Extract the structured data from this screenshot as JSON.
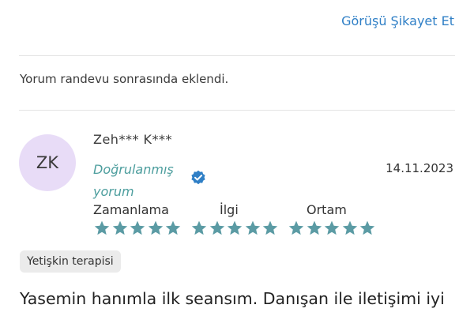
{
  "review_above": {
    "report_link": "Görüşü Şikayet Et"
  },
  "note": "Yorum randevu sonrasında eklendi.",
  "review": {
    "avatar_initials": "ZK",
    "reviewer_name": "Zeh*** K***",
    "verified_label": "Doğrulanmış yorum",
    "verified_icon": "verified-check-badge",
    "date": "14.11.2023",
    "ratings": [
      {
        "label": "Zamanlama",
        "stars": 5,
        "max": 5
      },
      {
        "label": "İlgi",
        "stars": 5,
        "max": 5
      },
      {
        "label": "Ortam",
        "stars": 5,
        "max": 5
      }
    ],
    "tag": "Yetişkin terapisi",
    "text": "Yasemin hanımla ilk seansım. Danışan ile iletişimi iyi"
  },
  "colors": {
    "link": "#2f7fc6",
    "verified": "#4d9e9e",
    "star": "#5b9ba4",
    "avatar_bg": "#e8dcf7",
    "tag_bg": "#ebebeb",
    "badge": "#2f7fc6"
  }
}
